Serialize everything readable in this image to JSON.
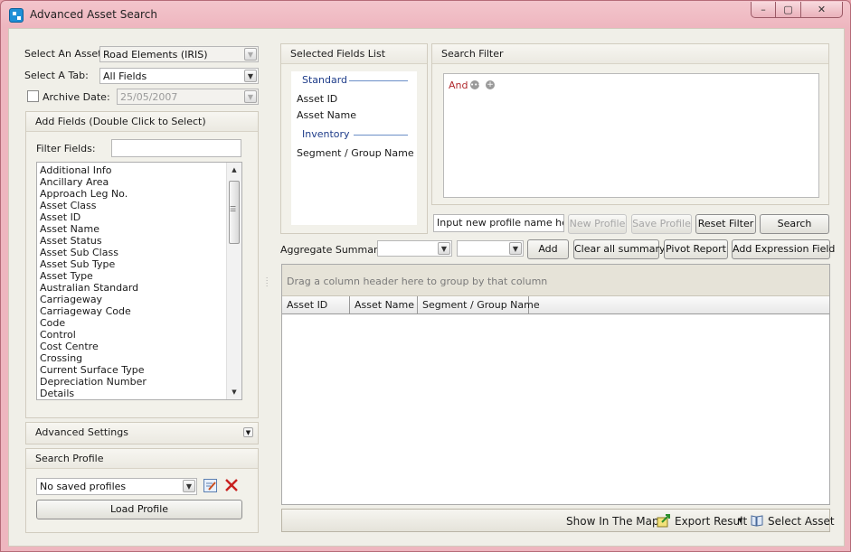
{
  "window": {
    "title": "Advanced Asset Search",
    "controls": {
      "minimize": "–",
      "maximize": "▢",
      "close": "✕"
    }
  },
  "left": {
    "select_asset_label": "Select An Asset:",
    "select_asset_value": "Road Elements (IRIS)",
    "select_tab_label": "Select A Tab:",
    "select_tab_value": "All Fields",
    "archive_label": "Archive Date:",
    "archive_value": "25/05/2007",
    "add_fields_header": "Add Fields (Double Click to Select)",
    "filter_fields_label": "Filter Fields:",
    "filter_fields_value": "",
    "fields": [
      "Additional Info",
      "Ancillary Area",
      "Approach Leg No.",
      "Asset Class",
      "Asset ID",
      "Asset Name",
      "Asset Status",
      "Asset Sub Class",
      "Asset Sub Type",
      "Asset Type",
      "Australian Standard",
      "Carriageway",
      "Carriageway Code",
      "Code",
      "Control",
      "Cost Centre",
      "Crossing",
      "Current Surface Type",
      "Depreciation Number",
      "Details"
    ],
    "advanced_settings": "Advanced Settings",
    "search_profile_header": "Search Profile",
    "profile_value": "No saved profiles",
    "load_profile": "Load Profile"
  },
  "selected_fields": {
    "header": "Selected Fields List",
    "sections": [
      {
        "title": "Standard",
        "items": [
          "Asset ID",
          "Asset Name"
        ]
      },
      {
        "title": "Inventory",
        "items": [
          "Segment / Group Name"
        ]
      }
    ]
  },
  "search_filter": {
    "header": "Search Filter",
    "operator": "And"
  },
  "profile_bar": {
    "profile_name_input": "Input new profile name here.",
    "new_profile": "New Profile",
    "save_profile": "Save Profile",
    "reset_filter": "Reset Filter",
    "search": "Search"
  },
  "aggregate": {
    "label": "Aggregate Summary:",
    "field_value": "",
    "function_value": "",
    "add": "Add",
    "clear": "Clear all summary",
    "pivot": "Pivot Report",
    "expression": "Add Expression Field"
  },
  "results": {
    "group_hint": "Drag a column header here to group by that column",
    "columns": [
      "Asset ID",
      "Asset Name",
      "Segment / Group Name"
    ]
  },
  "statusbar": {
    "show_in_map": "Show In The Map",
    "export_result": "Export Result",
    "select_asset": "Select Asset"
  },
  "colors": {
    "title_bar": "#eeb6bf",
    "panel_bg": "#f0efe8",
    "section_title": "#1f3d8a",
    "filter_operator": "#b0282c",
    "delete_icon": "#c8201f"
  }
}
